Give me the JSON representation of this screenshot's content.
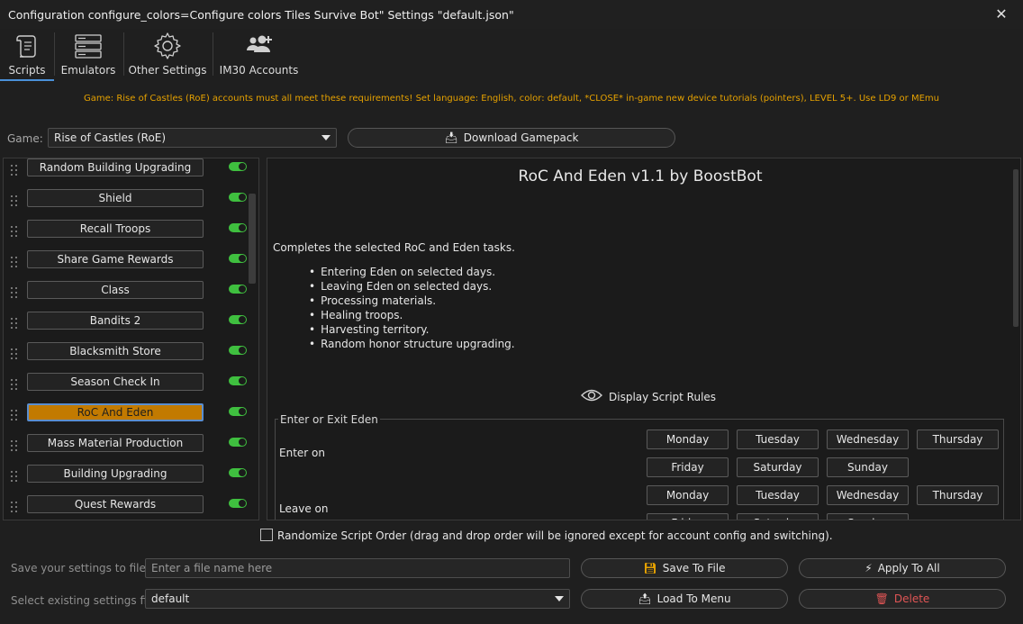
{
  "window": {
    "title": "Configuration configure_colors=Configure colors Tiles Survive Bot\" Settings \"default.json\"",
    "close_glyph": "✕"
  },
  "tabs": [
    {
      "label": "Scripts",
      "icon": "scroll-icon"
    },
    {
      "label": "Emulators",
      "icon": "server-icon"
    },
    {
      "label": "Other Settings",
      "icon": "gear-icon"
    },
    {
      "label": "IM30 Accounts",
      "icon": "users-add-icon"
    }
  ],
  "notice": "Game: Rise of Castles (RoE) accounts must all meet these requirements! Set language: English, color: default, *CLOSE* in-game new device tutorials (pointers), LEVEL 5+. Use LD9 or MEmu",
  "game": {
    "label": "Game:",
    "selected": "Rise of Castles (RoE)",
    "download_label": "Download Gamepack"
  },
  "scripts": [
    {
      "label": "Random Building Upgrading",
      "enabled": true,
      "active": false
    },
    {
      "label": "Shield",
      "enabled": true,
      "active": false
    },
    {
      "label": "Recall Troops",
      "enabled": true,
      "active": false
    },
    {
      "label": "Share Game Rewards",
      "enabled": true,
      "active": false
    },
    {
      "label": "Class",
      "enabled": true,
      "active": false
    },
    {
      "label": "Bandits 2",
      "enabled": true,
      "active": false
    },
    {
      "label": "Blacksmith Store",
      "enabled": true,
      "active": false
    },
    {
      "label": "Season Check In",
      "enabled": true,
      "active": false
    },
    {
      "label": "RoC And Eden",
      "enabled": true,
      "active": true
    },
    {
      "label": "Mass Material Production",
      "enabled": true,
      "active": false
    },
    {
      "label": "Building Upgrading",
      "enabled": true,
      "active": false
    },
    {
      "label": "Quest Rewards",
      "enabled": true,
      "active": false
    }
  ],
  "detail": {
    "title": "RoC And Eden v1.1 by BoostBot",
    "description": "Completes the selected RoC and Eden tasks.",
    "bullets": [
      "Entering Eden on selected days.",
      "Leaving Eden on selected days.",
      "Processing materials.",
      "Healing troops.",
      "Harvesting territory.",
      "Random honor structure upgrading."
    ],
    "rules_label": "Display Script Rules",
    "group_title": "Enter or Exit Eden",
    "enter_label": "Enter on",
    "leave_label": "Leave on",
    "enter_days": [
      "Monday",
      "Tuesday",
      "Wednesday",
      "Thursday",
      "Friday",
      "Saturday",
      "Sunday"
    ],
    "leave_days": [
      "Monday",
      "Tuesday",
      "Wednesday",
      "Thursday",
      "Friday",
      "Saturday",
      "Sunday"
    ]
  },
  "randomize_label": "Randomize Script Order (drag and drop order will be ignored except for account config and switching).",
  "save": {
    "label": "Save your settings to file",
    "placeholder": "Enter a file name here",
    "save_button": "Save To File",
    "apply_button": "Apply To All"
  },
  "load": {
    "label": "Select existing settings file",
    "selected": "default",
    "load_button": "Load To Menu",
    "delete_button": "Delete"
  },
  "colors": {
    "accent": "#c27a00",
    "notice": "#e5a100",
    "toggle_on": "#3fbf3f",
    "delete": "#e05555",
    "tab_underline": "#4a90d9"
  }
}
